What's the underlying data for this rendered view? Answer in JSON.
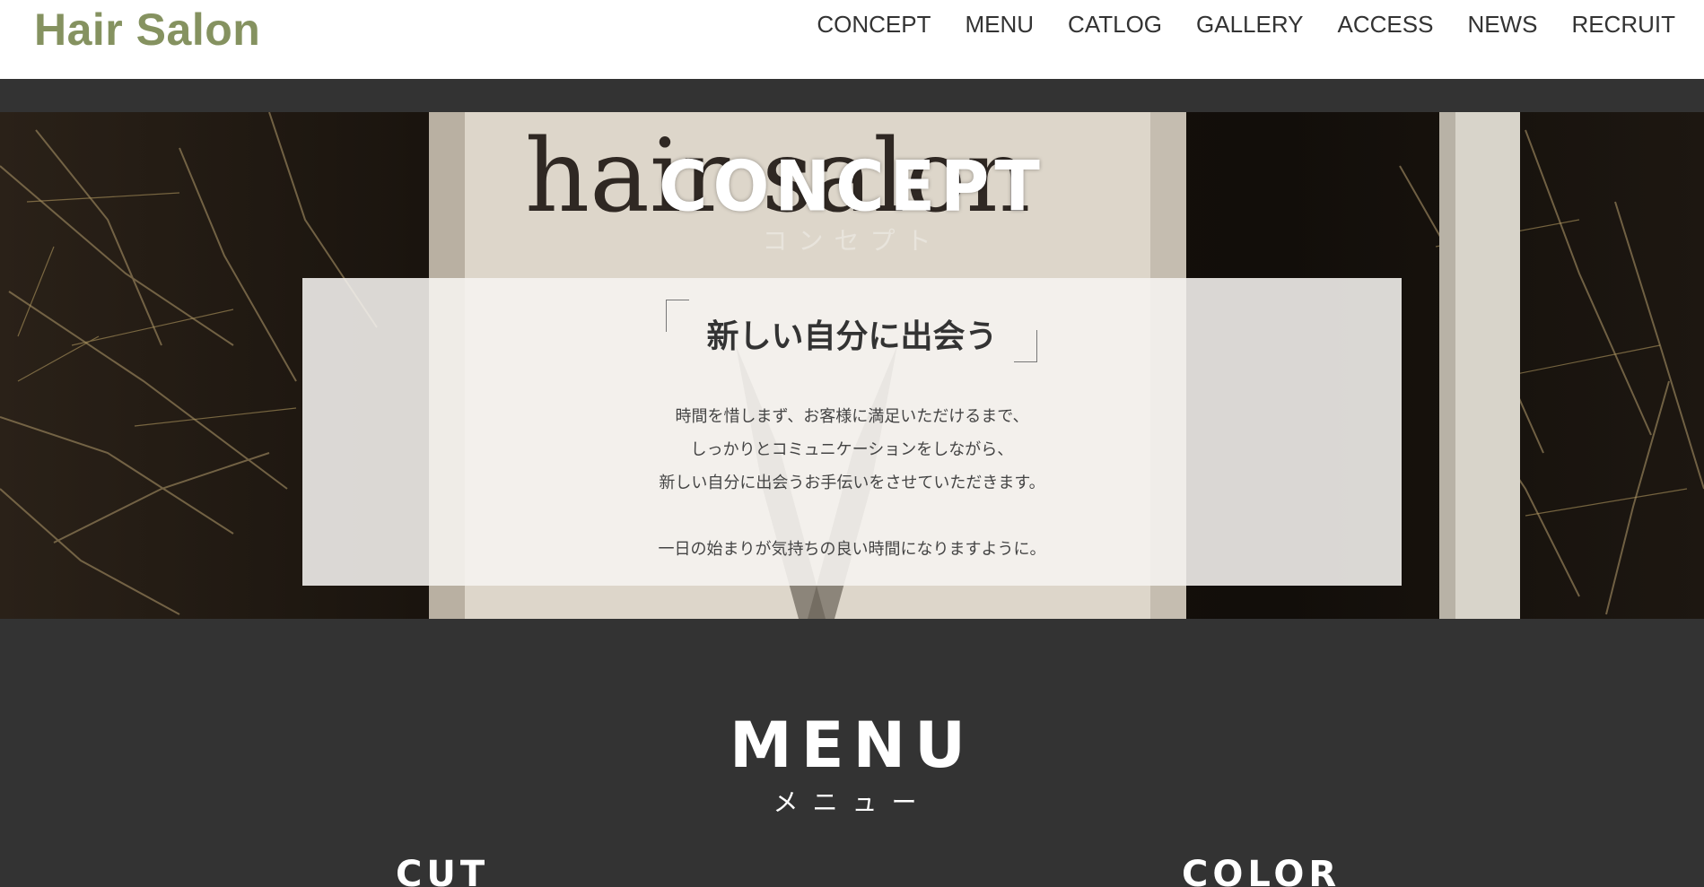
{
  "header": {
    "logo": "Hair Salon",
    "nav": [
      "CONCEPT",
      "MENU",
      "CATLOG",
      "GALLERY",
      "ACCESS",
      "NEWS",
      "RECRUIT"
    ]
  },
  "concept": {
    "title": "CONCEPT",
    "subtitle": "コンセプト",
    "sign_text": "hair salon",
    "catch": "新しい自分に出会う",
    "lines": [
      "時間を惜しまず、お客様に満足いただけるまで、",
      "しっかりとコミュニケーションをしながら、",
      "新しい自分に出会うお手伝いをさせていただきます。",
      "",
      "一日の始まりが気持ちの良い時間になりますように。"
    ]
  },
  "menu": {
    "title": "MENU",
    "subtitle": "メニュー",
    "categories": [
      "CUT",
      "COLOR"
    ]
  },
  "colors": {
    "logo": "#859260",
    "dark_bg": "#333333"
  }
}
